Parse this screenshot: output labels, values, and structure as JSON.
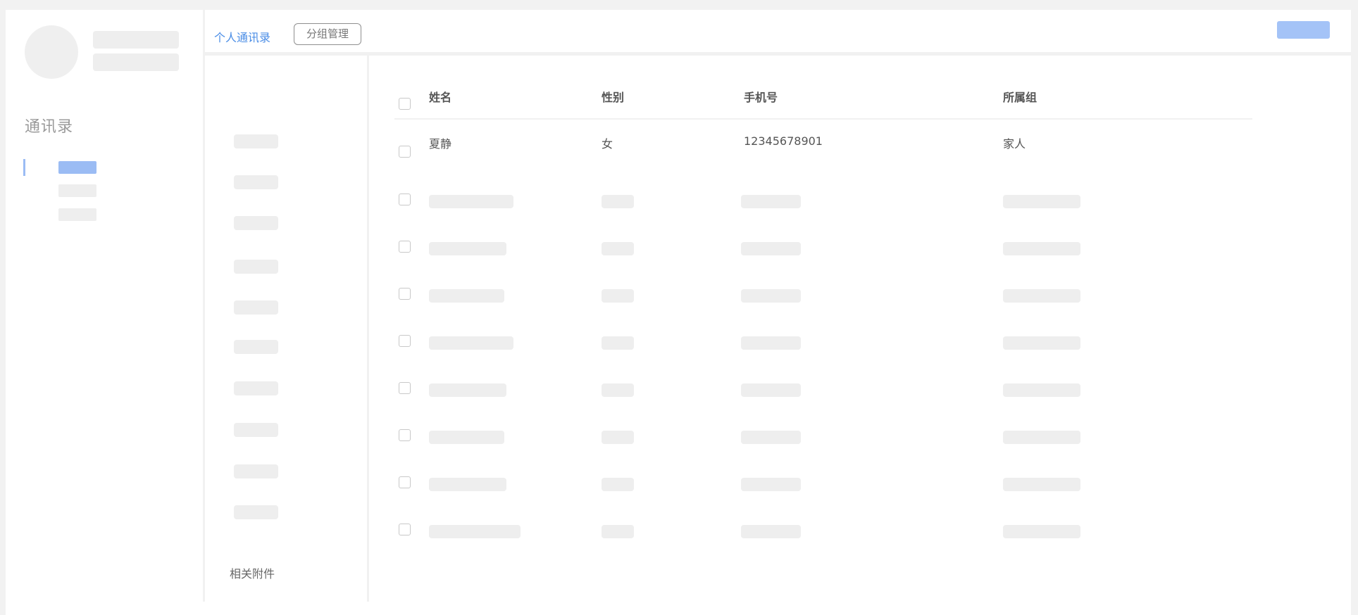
{
  "sidebar": {
    "title": "通讯录"
  },
  "topbar": {
    "tabs": [
      {
        "label": "个人通讯录",
        "active": true
      },
      {
        "label": "分组管理",
        "active": false
      }
    ]
  },
  "groups_panel": {
    "footer_label": "相关附件"
  },
  "contacts": {
    "columns": [
      "姓名",
      "性别",
      "手机号",
      "所属组"
    ],
    "rows": [
      {
        "name": "夏静",
        "gender": "女",
        "phone": "12345678901",
        "group": "家人"
      }
    ]
  },
  "colors": {
    "accent": "#4a8de6",
    "accent_light": "#a4c3f7",
    "skeleton": "#eeeeee",
    "divider": "#f1f1f1"
  }
}
